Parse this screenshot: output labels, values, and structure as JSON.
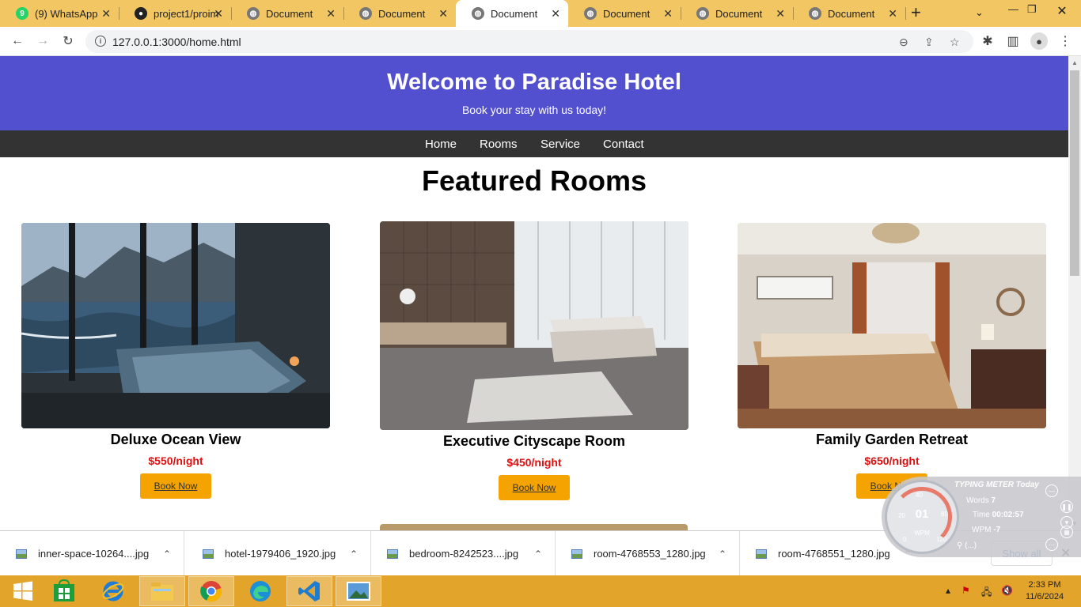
{
  "browser": {
    "tabs": [
      {
        "title": "(9) WhatsApp",
        "icon": "whatsapp-icon",
        "active": false
      },
      {
        "title": "project1/proim",
        "icon": "github-icon",
        "active": false
      },
      {
        "title": "Document",
        "icon": "globe-icon",
        "active": false
      },
      {
        "title": "Document",
        "icon": "globe-icon",
        "active": false
      },
      {
        "title": "Document",
        "icon": "globe-icon",
        "active": true
      },
      {
        "title": "Document",
        "icon": "globe-icon",
        "active": false
      },
      {
        "title": "Document",
        "icon": "globe-icon",
        "active": false
      },
      {
        "title": "Document",
        "icon": "globe-icon",
        "active": false
      }
    ],
    "whatsapp_badge": "9",
    "url": "127.0.0.1:3000/home.html",
    "accent": "#f1c663"
  },
  "site": {
    "title": "Welcome to Paradise Hotel",
    "subtitle": "Book your stay with us today!",
    "header_color": "#5350cf",
    "nav": [
      "Home",
      "Rooms",
      "Service",
      "Contact"
    ],
    "section_title": "Featured Rooms",
    "rooms": [
      {
        "name": "Deluxe Ocean View",
        "price": "$550/night",
        "button": "Book Now"
      },
      {
        "name": "Executive Cityscape Room",
        "price": "$450/night",
        "button": "Book Now"
      },
      {
        "name": "Family Garden Retreat",
        "price": "$650/night",
        "button": "Book Now"
      }
    ],
    "price_color": "#e01010",
    "button_color": "#f5a300"
  },
  "downloads": {
    "files": [
      "inner-space-10264....jpg",
      "hotel-1979406_1920.jpg",
      "bedroom-8242523....jpg",
      "room-4768553_1280.jpg",
      "room-4768551_1280.jpg"
    ],
    "show_all": "Show all"
  },
  "typing_meter": {
    "title": "TYPING METER Today",
    "words_label": "Words",
    "words": "7",
    "time_label": "Time",
    "time": "00:02:57",
    "wpm_label": "WPM",
    "wpm_value": "-7",
    "gauge_value": "01",
    "gauge_unit": "WPM",
    "ticks": [
      "20",
      "40",
      "80",
      "120",
      "0"
    ],
    "search": "(...)"
  },
  "taskbar": {
    "apps": [
      "start-icon",
      "store-icon",
      "ie-icon",
      "explorer-icon",
      "chrome-icon",
      "edge-icon",
      "vscode-icon",
      "photos-icon"
    ],
    "time": "2:33 PM",
    "date": "11/6/2024"
  }
}
